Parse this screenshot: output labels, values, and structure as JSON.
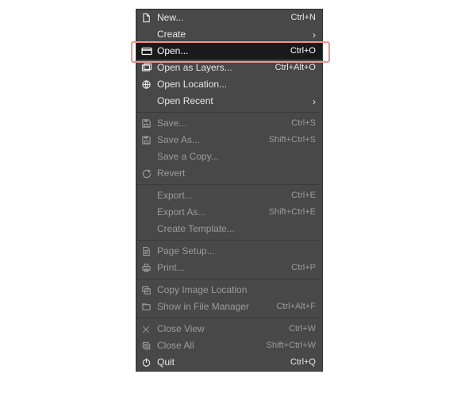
{
  "menu": {
    "groups": [
      [
        {
          "icon": "new-doc-icon",
          "label": "New...",
          "shortcut": "Ctrl+N",
          "submenu": false,
          "enabled": true,
          "highlight": false
        },
        {
          "icon": "",
          "label": "Create",
          "shortcut": "",
          "submenu": true,
          "enabled": true,
          "highlight": false
        },
        {
          "icon": "open-icon",
          "label": "Open...",
          "shortcut": "Ctrl+O",
          "submenu": false,
          "enabled": true,
          "highlight": true
        },
        {
          "icon": "layers-icon",
          "label": "Open as Layers...",
          "shortcut": "Ctrl+Alt+O",
          "submenu": false,
          "enabled": true,
          "highlight": false
        },
        {
          "icon": "location-icon",
          "label": "Open Location...",
          "shortcut": "",
          "submenu": false,
          "enabled": true,
          "highlight": false
        },
        {
          "icon": "",
          "label": "Open Recent",
          "shortcut": "",
          "submenu": true,
          "enabled": true,
          "highlight": false
        }
      ],
      [
        {
          "icon": "save-icon",
          "label": "Save...",
          "shortcut": "Ctrl+S",
          "submenu": false,
          "enabled": false,
          "highlight": false
        },
        {
          "icon": "save-as-icon",
          "label": "Save As...",
          "shortcut": "Shift+Ctrl+S",
          "submenu": false,
          "enabled": false,
          "highlight": false
        },
        {
          "icon": "",
          "label": "Save a Copy...",
          "shortcut": "",
          "submenu": false,
          "enabled": false,
          "highlight": false
        },
        {
          "icon": "revert-icon",
          "label": "Revert",
          "shortcut": "",
          "submenu": false,
          "enabled": false,
          "highlight": false
        }
      ],
      [
        {
          "icon": "",
          "label": "Export...",
          "shortcut": "Ctrl+E",
          "submenu": false,
          "enabled": false,
          "highlight": false
        },
        {
          "icon": "",
          "label": "Export As...",
          "shortcut": "Shift+Ctrl+E",
          "submenu": false,
          "enabled": false,
          "highlight": false
        },
        {
          "icon": "",
          "label": "Create Template...",
          "shortcut": "",
          "submenu": false,
          "enabled": false,
          "highlight": false
        }
      ],
      [
        {
          "icon": "page-setup-icon",
          "label": "Page Setup...",
          "shortcut": "",
          "submenu": false,
          "enabled": false,
          "highlight": false
        },
        {
          "icon": "print-icon",
          "label": "Print...",
          "shortcut": "Ctrl+P",
          "submenu": false,
          "enabled": false,
          "highlight": false
        }
      ],
      [
        {
          "icon": "copy-location-icon",
          "label": "Copy Image Location",
          "shortcut": "",
          "submenu": false,
          "enabled": false,
          "highlight": false
        },
        {
          "icon": "file-manager-icon",
          "label": "Show in File Manager",
          "shortcut": "Ctrl+Alt+F",
          "submenu": false,
          "enabled": false,
          "highlight": false
        }
      ],
      [
        {
          "icon": "close-icon",
          "label": "Close View",
          "shortcut": "Ctrl+W",
          "submenu": false,
          "enabled": false,
          "highlight": false
        },
        {
          "icon": "close-all-icon",
          "label": "Close All",
          "shortcut": "Shift+Ctrl+W",
          "submenu": false,
          "enabled": false,
          "highlight": false
        },
        {
          "icon": "quit-icon",
          "label": "Quit",
          "shortcut": "Ctrl+Q",
          "submenu": false,
          "enabled": true,
          "highlight": false
        }
      ]
    ]
  }
}
